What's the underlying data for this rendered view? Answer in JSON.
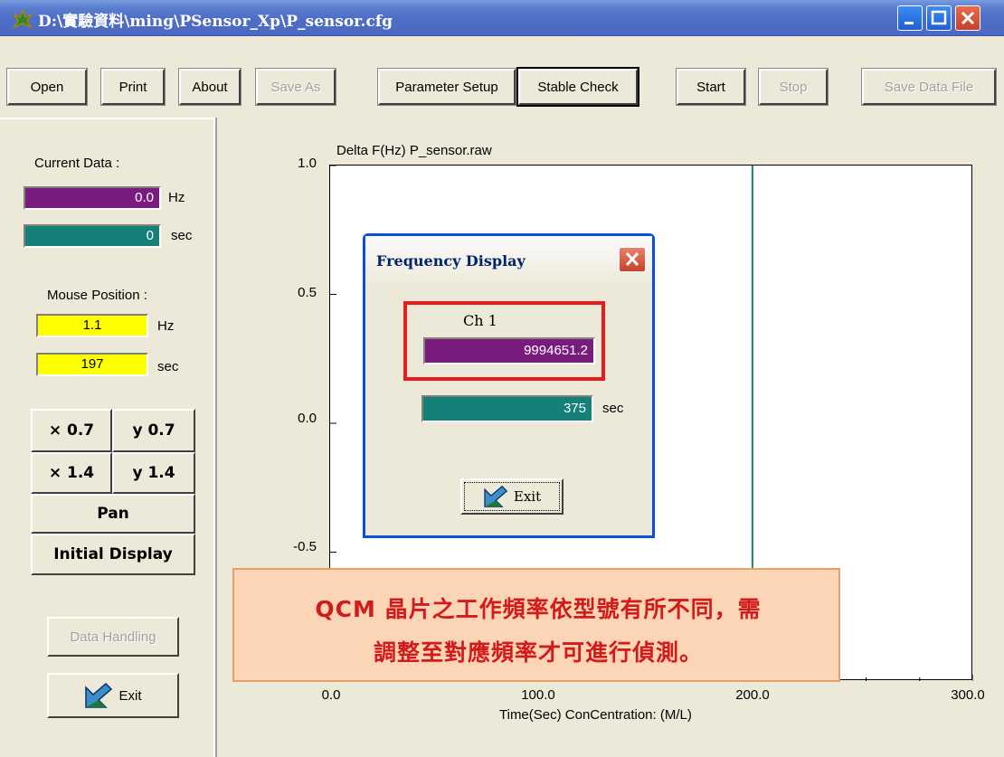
{
  "window": {
    "title": "D:\\實驗資料\\ming\\PSensor_Xp\\P_sensor.cfg",
    "accent_color": "#4a68c1"
  },
  "toolbar": {
    "open": "Open",
    "print": "Print",
    "about": "About",
    "save_as": "Save As",
    "parameter_setup": "Parameter Setup",
    "stable_check": "Stable Check",
    "start": "Start",
    "stop": "Stop",
    "save_data_file": "Save Data File"
  },
  "left_panel": {
    "current_data_label": "Current Data :",
    "current_hz_value": "0.0",
    "hz_unit": "Hz",
    "current_sec_value": "0",
    "sec_unit": "sec",
    "mouse_position_label": "Mouse Position :",
    "mouse_hz_value": "1.1",
    "mouse_sec_value": "197",
    "btn_x07": "× 0.7",
    "btn_y07": "y 0.7",
    "btn_x14": "× 1.4",
    "btn_y14": "y 1.4",
    "btn_pan": "Pan",
    "btn_initial_display": "Initial Display",
    "btn_data_handling": "Data Handling",
    "btn_exit": "Exit"
  },
  "chart_data": {
    "type": "line",
    "title": "Delta F(Hz)    P_sensor.raw",
    "xlabel": "Time(Sec)  ConCentration:  (M/L)",
    "ylabel": "Delta F(Hz)",
    "x_ticks": [
      "0.0",
      "100.0",
      "200.0",
      "300.0"
    ],
    "y_ticks": [
      "1.0",
      "0.5",
      "0.0",
      "-0.5"
    ],
    "xlim": [
      0,
      300
    ],
    "ylim": [
      -1.0,
      1.0
    ],
    "cursor_x": 197,
    "cursor_color": "#148078",
    "series": []
  },
  "dialog": {
    "title": "Frequency Display",
    "channel_label": "Ch 1",
    "channel_value": "9994651.2",
    "time_value": "375",
    "time_unit": "sec",
    "exit_label": "Exit"
  },
  "callout": {
    "line1": "QCM 晶片之工作頻率依型號有所不同，需",
    "line2": "調整至對應頻率才可進行偵測。"
  }
}
